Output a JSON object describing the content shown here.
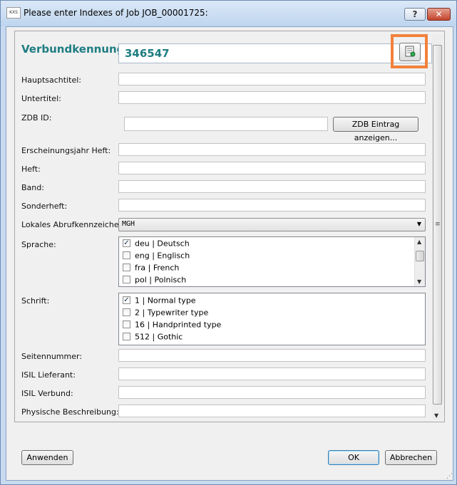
{
  "window": {
    "title": "Please enter Indexes of Job JOB_00001725:",
    "app_icon_text": "KXS",
    "help_label": "?",
    "close_label": "✕"
  },
  "form": {
    "verbundkennung": {
      "label": "Verbundkennung:",
      "value": "346547",
      "lookup_icon": "document-search-icon"
    },
    "hauptsachtitel": {
      "label": "Hauptsachtitel:",
      "value": ""
    },
    "untertitel": {
      "label": "Untertitel:",
      "value": ""
    },
    "zdb": {
      "label": "ZDB ID:",
      "value": "",
      "button": "ZDB Eintrag anzeigen..."
    },
    "erscheinungsjahr": {
      "label": "Erscheinungsjahr Heft:",
      "value": ""
    },
    "heft": {
      "label": "Heft:",
      "value": ""
    },
    "band": {
      "label": "Band:",
      "value": ""
    },
    "sonderheft": {
      "label": "Sonderheft:",
      "value": ""
    },
    "abrufkennzeichen": {
      "label": "Lokales Abrufkennzeichen:",
      "value": "MGH"
    },
    "sprache": {
      "label": "Sprache:",
      "items": [
        {
          "label": "deu | Deutsch",
          "checked": true
        },
        {
          "label": "eng | Englisch",
          "checked": false
        },
        {
          "label": "fra | French",
          "checked": false
        },
        {
          "label": "pol  | Polnisch",
          "checked": false
        }
      ]
    },
    "schrift": {
      "label": "Schrift:",
      "items": [
        {
          "label": "1 | Normal type",
          "checked": true
        },
        {
          "label": "2 | Typewriter type",
          "checked": false
        },
        {
          "label": "16 | Handprinted type",
          "checked": false
        },
        {
          "label": "512 | Gothic",
          "checked": false
        }
      ]
    },
    "seitennummer": {
      "label": "Seitennummer:",
      "value": ""
    },
    "isil_lieferant": {
      "label": "ISIL Lieferant:",
      "value": ""
    },
    "isil_verbund": {
      "label": "ISIL Verbund:",
      "value": ""
    },
    "physische_beschreibung": {
      "label": "Physische Beschreibung:",
      "value": ""
    }
  },
  "footer": {
    "apply": "Anwenden",
    "ok": "OK",
    "cancel": "Abbrechen"
  },
  "colors": {
    "accent_teal": "#1e7d82",
    "highlight_orange": "#f2813c"
  },
  "glyphs": {
    "check": "✓",
    "dropdown": "▼",
    "scroll_up": "▲",
    "scroll_down": "▼",
    "grip": "≡",
    "resize": "⋰"
  }
}
